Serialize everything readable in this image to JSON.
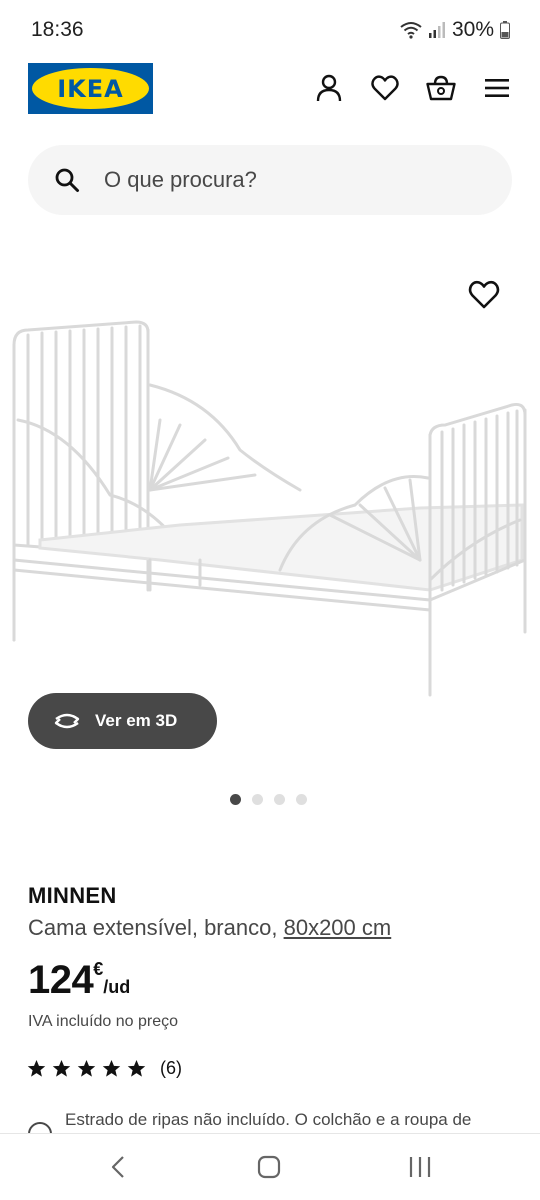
{
  "status_bar": {
    "time": "18:36",
    "battery": "30%"
  },
  "header": {
    "logo_text": "IKEA",
    "icons": [
      "user-icon",
      "heart-icon",
      "basket-icon",
      "menu-icon"
    ]
  },
  "search": {
    "placeholder": "O que procura?"
  },
  "gallery": {
    "view_3d_label": "Ver em 3D",
    "image_count": 4,
    "active_index": 0
  },
  "product": {
    "name": "MINNEN",
    "description": "Cama extensível, branco,",
    "size": "80x200 cm",
    "price_integer": "124",
    "currency": "€",
    "unit": "/ud",
    "vat_note": "IVA incluído no preço",
    "rating_stars": 5,
    "rating_count": "(6)",
    "info_text": "Estrado de ripas não incluído. O colchão e a roupa de"
  },
  "colors": {
    "ikea_blue": "#0058a3",
    "ikea_yellow": "#ffdb00",
    "dark_button": "#484848",
    "search_bg": "#f5f5f5"
  }
}
